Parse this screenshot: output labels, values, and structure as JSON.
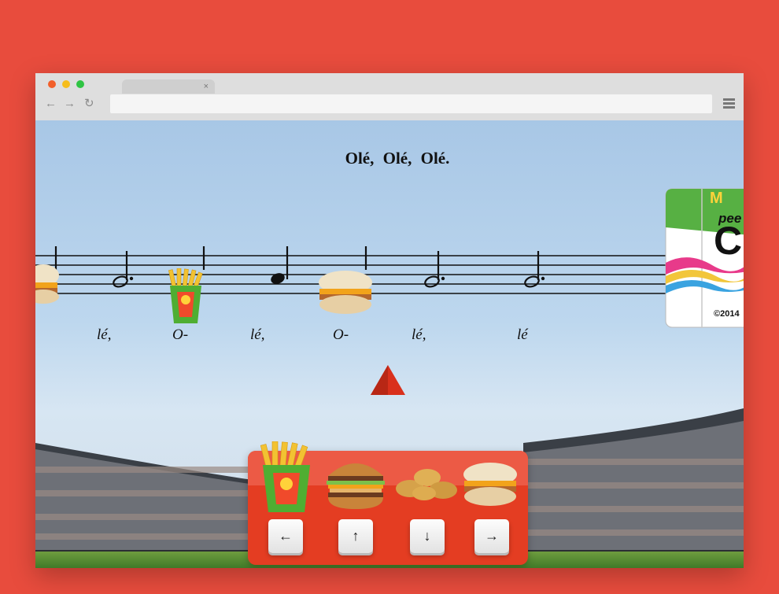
{
  "browser": {
    "tab_title": "",
    "tab_close": "×",
    "back_icon": "←",
    "forward_icon": "→",
    "reload_icon": "↻",
    "address_value": "",
    "menu_icon": "hamburger-menu-icon"
  },
  "song": {
    "title": "Olé, Olé, Olé.",
    "syllables": [
      "lé,",
      "O-",
      "lé,",
      "O-",
      "lé,",
      "lé"
    ]
  },
  "card": {
    "brand": "M",
    "word": "pee",
    "letter": "C",
    "copyright": "©2014"
  },
  "controls": {
    "left_key": "←",
    "up_key": "↑",
    "down_key": "↓",
    "right_key": "→",
    "items": [
      "fries-icon",
      "big-mac-icon",
      "nuggets-icon",
      "muffin-sandwich-icon"
    ]
  },
  "colors": {
    "background": "#e84c3d",
    "keypad": "#e43d22",
    "marker": "#d9301c"
  }
}
